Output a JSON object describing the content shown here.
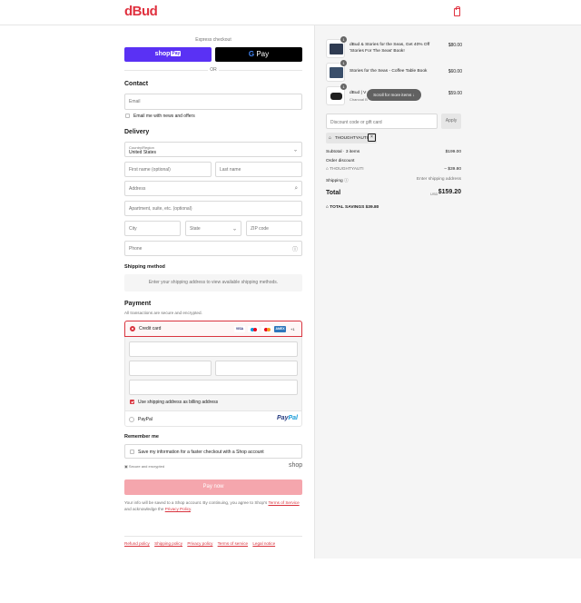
{
  "header": {
    "logo": "dBud",
    "cart_icon": "shopping-bag-icon"
  },
  "express": {
    "label": "Express checkout",
    "shop_pay": {
      "word": "shop",
      "badge": "Pay"
    },
    "google_pay": {
      "g": "G",
      "word": "Pay"
    },
    "or": "OR"
  },
  "contact": {
    "title": "Contact",
    "email_placeholder": "Email",
    "news_label": "Email me with news and offers"
  },
  "delivery": {
    "title": "Delivery",
    "country_label": "Country/Region",
    "country_value": "United States",
    "first_name": "First name (optional)",
    "last_name": "Last name",
    "address": "Address",
    "apartment": "Apartment, suite, etc. (optional)",
    "city": "City",
    "state": "State",
    "zip": "ZIP code",
    "phone": "Phone"
  },
  "shipping_method": {
    "title": "Shipping method",
    "note": "Enter your shipping address to view available shipping methods."
  },
  "payment": {
    "title": "Payment",
    "subtitle": "All transactions are secure and encrypted.",
    "credit_card_label": "Credit card",
    "card_logos": [
      "VISA",
      "MC",
      "MC",
      "AMEX"
    ],
    "more_cards": "+1",
    "billing_label": "Use shipping address as billing address",
    "paypal_label": "PayPal",
    "paypal_logo": {
      "a": "Pay",
      "b": "Pal"
    }
  },
  "remember": {
    "title": "Remember me",
    "save_label": "Save my information for a faster checkout with a Shop account",
    "secure_text": "Secure and encrypted",
    "shop_word": "shop"
  },
  "pay_now": "Pay now",
  "terms": {
    "text1": "Your info will be saved to a Shop account. By continuing, you agree to Shop's ",
    "terms_link": "Terms of Service",
    "text2": " and acknowledge the ",
    "privacy_link": "Privacy Policy",
    "text3": "."
  },
  "footer": {
    "links": [
      "Refund policy",
      "Shipping policy",
      "Privacy policy",
      "Terms of service",
      "Legal notice"
    ]
  },
  "order": {
    "items": [
      {
        "qty": "1",
        "name": "dBud & Stories for the Seas, Get 40% Off 'Stories For The Seas' Book!",
        "sub": "",
        "price": "$80.00",
        "color": "#2f3b52"
      },
      {
        "qty": "1",
        "name": "Stories for the Seas - Coffee Table Book",
        "sub": "",
        "price": "$60.00",
        "color": "#3a4f6b"
      },
      {
        "qty": "1",
        "name": "dBud | V",
        "sub": "Charcoal B",
        "price": "$59.00",
        "color": "#1f1f1f"
      }
    ],
    "tooltip": "Scroll for more items",
    "discount_placeholder": "Discount code or gift card",
    "apply": "Apply",
    "applied_code": "THOUGHTYAUTI",
    "remove_symbol": "×",
    "subtotal_label": "Subtotal · 3 items",
    "subtotal_value": "$199.00",
    "order_discount_label": "Order discount",
    "discount_code": "THOUGHTYAUTI",
    "discount_value": "– $39.80",
    "shipping_label": "Shipping",
    "shipping_value": "Enter shipping address",
    "total_label": "Total",
    "total_currency": "USD",
    "total_value": "$159.20",
    "savings_label": "TOTAL SAVINGS",
    "savings_value": "$39.80"
  }
}
